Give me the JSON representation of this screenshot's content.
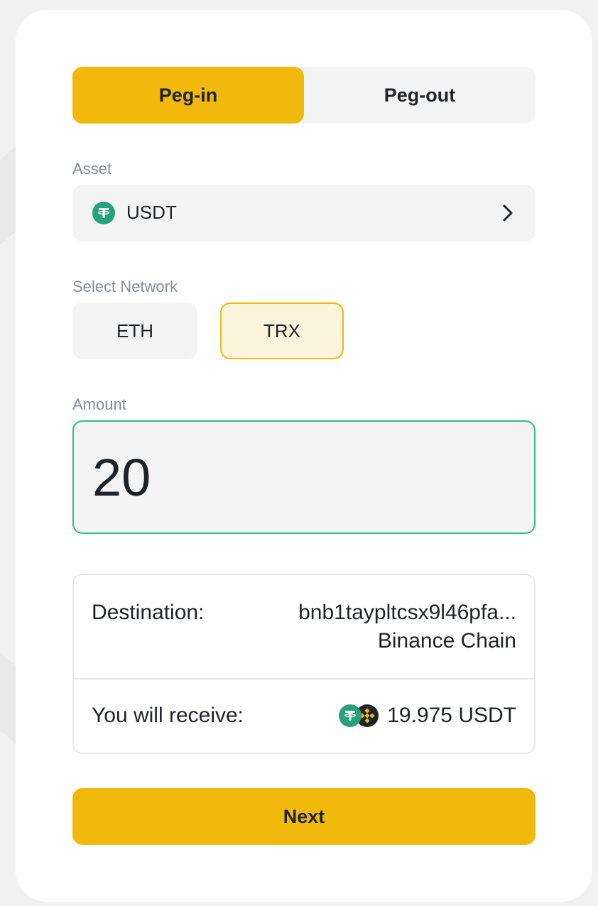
{
  "tabs": {
    "active": "Peg-in",
    "inactive": "Peg-out"
  },
  "asset": {
    "label": "Asset",
    "value": "USDT",
    "icon": "usdt-icon"
  },
  "network": {
    "label": "Select Network",
    "options": [
      "ETH",
      "TRX"
    ],
    "selected": "TRX"
  },
  "amount": {
    "label": "Amount",
    "value": "20"
  },
  "summary": {
    "destination_label": "Destination:",
    "destination_address": "bnb1tayplt­csx9l46pfa...",
    "destination_chain": "Binance Chain",
    "receive_label": "You will receive:",
    "receive_amount": "19.975 USDT",
    "receive_icons": [
      "usdt-icon",
      "bnb-icon"
    ]
  },
  "next_label": "Next",
  "colors": {
    "accent": "#f0b90b",
    "accent_soft": "#fdf4dc",
    "input_focus": "#2ebd85",
    "usdt": "#26a17b",
    "bnb_bg": "#1e2329",
    "bnb_gold": "#f0b90b"
  }
}
